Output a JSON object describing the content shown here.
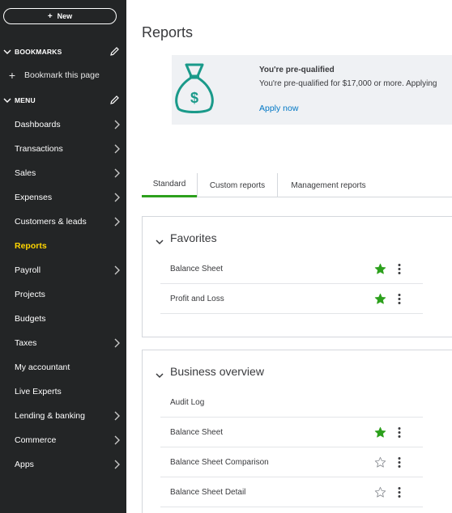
{
  "sidebar": {
    "new_label": "New",
    "bookmarks_label": "BOOKMARKS",
    "bookmark_this_page": "Bookmark this page",
    "menu_label": "MENU",
    "items": [
      {
        "label": "Dashboards",
        "has_arrow": true
      },
      {
        "label": "Transactions",
        "has_arrow": true
      },
      {
        "label": "Sales",
        "has_arrow": true
      },
      {
        "label": "Expenses",
        "has_arrow": true
      },
      {
        "label": "Customers & leads",
        "has_arrow": true
      },
      {
        "label": "Reports",
        "has_arrow": false,
        "active": true
      },
      {
        "label": "Payroll",
        "has_arrow": true
      },
      {
        "label": "Projects",
        "has_arrow": false
      },
      {
        "label": "Budgets",
        "has_arrow": false
      },
      {
        "label": "Taxes",
        "has_arrow": true
      },
      {
        "label": "My accountant",
        "has_arrow": false
      },
      {
        "label": "Live Experts",
        "has_arrow": false
      },
      {
        "label": "Lending & banking",
        "has_arrow": true
      },
      {
        "label": "Commerce",
        "has_arrow": true
      },
      {
        "label": "Apps",
        "has_arrow": true
      }
    ]
  },
  "page": {
    "title": "Reports"
  },
  "promo": {
    "title": "You're pre-qualified",
    "text": "You're pre-qualified for $17,000 or more. Applying",
    "link": "Apply now",
    "icon": "money-bag-icon"
  },
  "tabs": [
    {
      "label": "Standard",
      "active": true
    },
    {
      "label": "Custom reports",
      "active": false
    },
    {
      "label": "Management reports",
      "active": false
    }
  ],
  "favorites": {
    "title": "Favorites",
    "rows": [
      {
        "label": "Balance Sheet",
        "starred": true
      },
      {
        "label": "Profit and Loss",
        "starred": true
      }
    ]
  },
  "business_overview": {
    "title": "Business overview",
    "rows": [
      {
        "label": "Audit Log",
        "starred": null
      },
      {
        "label": "Balance Sheet",
        "starred": true
      },
      {
        "label": "Balance Sheet Comparison",
        "starred": false
      },
      {
        "label": "Balance Sheet Detail",
        "starred": false
      }
    ]
  },
  "colors": {
    "sidebar_bg": "#232526",
    "active_nav": "#ffd500",
    "accent_green": "#2ca01c",
    "link_blue": "#0077c5",
    "promo_icon": "#1a9a8a"
  }
}
